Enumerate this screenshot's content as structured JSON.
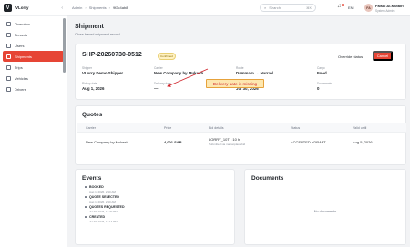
{
  "sidebar": {
    "brand": "VLorry",
    "items": [
      {
        "label": "Overview"
      },
      {
        "label": "Tenants"
      },
      {
        "label": "Users"
      },
      {
        "label": "Shipments"
      },
      {
        "label": "Trips"
      },
      {
        "label": "Vehicles"
      },
      {
        "label": "Drivers"
      }
    ]
  },
  "topbar": {
    "breadcrumb": [
      "Admin",
      "Shipments",
      "9f2c4ab8"
    ],
    "search_placeholder": "Search",
    "search_shortcut": "⌘K",
    "lang": "EN",
    "avatar_initials": "FA",
    "user_name": "Faisal Al-Mutairi",
    "user_role": "System Admin"
  },
  "page": {
    "title": "Shipment",
    "subtitle": "Close-based shipment record."
  },
  "shipment": {
    "id": "SHP-20260730-0512",
    "badge": "Confirmed",
    "override_label": "Override status",
    "cancel_label": "Cancel",
    "fields": {
      "shipper_label": "Shipper",
      "shipper": "VLorry Demo Shipper",
      "carrier_label": "Carrier",
      "carrier": "New Company by Mukesh",
      "route_label": "Route",
      "route": "Dammam → Harrad",
      "cargo_label": "Cargo",
      "cargo": "Food",
      "pickup_label": "Pickup date",
      "pickup": "Aug 1, 2026",
      "delivery_label": "Delivery date",
      "delivery": "—",
      "created_label": "Created",
      "created": "Jul 30, 2026",
      "documents_label": "Documents",
      "documents": "0"
    },
    "callout": "Delivery date is missing"
  },
  "quotes": {
    "title": "Quotes",
    "columns": [
      "Carrier",
      "Price",
      "Bid details",
      "Status",
      "Valid until"
    ],
    "rows": [
      {
        "carrier": "New Company by Mukesh",
        "price": "4,001 SAR",
        "bid": "LORRY_10T • 10 h",
        "bid_sub": "Submitted via marketplace bid",
        "status": "ACCEPTED • DRAFT",
        "valid_until": "Aug 5, 2026"
      }
    ]
  },
  "events": {
    "title": "Events",
    "items": [
      {
        "title": "BOOKED",
        "date": "Aug 1, 2026, 2:10 AM"
      },
      {
        "title": "QUOTE SELECTED",
        "date": "Aug 1, 2026, 2:10 AM"
      },
      {
        "title": "QUOTES REQUESTED",
        "date": "Jul 30, 2026, 11:20 PM"
      },
      {
        "title": "CREATED",
        "date": "Jul 30, 2026, 11:14 PM"
      }
    ]
  },
  "documents": {
    "title": "Documents",
    "empty": "No documents"
  },
  "colors": {
    "accent": "#e64535",
    "callout_bg": "#fde7b0",
    "callout_text": "#d0232a"
  }
}
